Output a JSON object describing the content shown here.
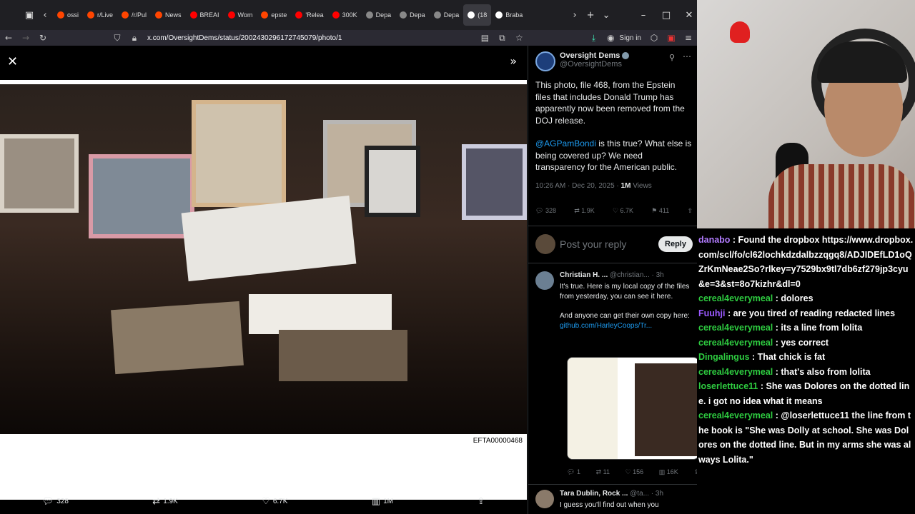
{
  "tabs": [
    {
      "label": "ossi",
      "color": "#ff4500"
    },
    {
      "label": "r/Live",
      "color": "#ff4500"
    },
    {
      "label": "/r/Pul",
      "color": "#ff4500"
    },
    {
      "label": "News",
      "color": "#ff4500"
    },
    {
      "label": "BREAI",
      "color": "#ff0000"
    },
    {
      "label": "Wom",
      "color": "#ff0000"
    },
    {
      "label": "epste",
      "color": "#ff4500"
    },
    {
      "label": "'Relea",
      "color": "#ff0000"
    },
    {
      "label": "300K",
      "color": "#ff0000"
    },
    {
      "label": "Depa",
      "color": "#888888"
    },
    {
      "label": "Depa",
      "color": "#888888"
    },
    {
      "label": "Depa",
      "color": "#888888"
    },
    {
      "label": "(18",
      "color": "#ffffff"
    },
    {
      "label": "Braba",
      "color": "#ffffff"
    }
  ],
  "url": "x.com/OversightDems/status/2002430296172745079/photo/1",
  "sign_in": "Sign in",
  "photo": {
    "caption_code": "EFTA00000468"
  },
  "viewer_actions": {
    "replies": "328",
    "reposts": "1.9K",
    "likes": "6.7K",
    "views": "1M"
  },
  "post": {
    "name": "Oversight Dems",
    "handle": "@OversightDems",
    "text1": "This photo, file 468, from the Epstein files that includes Donald Trump has apparently now been removed from the DOJ release.",
    "mention": "@AGPamBondi",
    "text2": " is this true? What else is being covered up? We need transparency for the American public.",
    "time": "10:26 AM · Dec 20, 2025 · ",
    "views_count": "1M",
    "views_label": " Views",
    "replies": "328",
    "reposts": "1.9K",
    "likes": "6.7K",
    "bookmarks": "411"
  },
  "reply": {
    "placeholder": "Post your reply",
    "button": "Reply"
  },
  "comment1": {
    "name": "Christian H. ...",
    "handle": "@christian... · 3h",
    "text1": "It's true. Here is my local copy of the files from yesterday, you can see it here.",
    "text2": "And anyone can get their own copy here:",
    "link": "github.com/HarleyCoops/Tr...",
    "replies": "1",
    "reposts": "11",
    "likes": "156",
    "views": "16K"
  },
  "comment2": {
    "name": "Tara Dublin, Rock ...",
    "handle": "@ta... · 3h",
    "text": "I guess you'll find out when you"
  },
  "chat": [
    {
      "user": "danabo",
      "color": "#b27cff",
      "text": " : Found the dropbox https://www.dropbox.com/scl/fo/cl62lochkdzdalbzzqgq8/ADJIDEfLD1oQZrKmNeae2So?rlkey=y7529bx9tl7db6zf279jp3cyu&e=3&st=8o7kizhr&dl=0"
    },
    {
      "user": "cereal4everymeal",
      "color": "#2ecc40",
      "text": " : dolores"
    },
    {
      "user": "Fuuhji",
      "color": "#9b59ff",
      "text": " : are you tired of reading redacted lines"
    },
    {
      "user": "cereal4everymeal",
      "color": "#2ecc40",
      "text": " : its a line from lolita"
    },
    {
      "user": "cereal4everymeal",
      "color": "#2ecc40",
      "text": " : yes correct"
    },
    {
      "user": "Dingalingus",
      "color": "#2ecc40",
      "text": " : That chick is fat"
    },
    {
      "user": "cereal4everymeal",
      "color": "#2ecc40",
      "text": " : that's also from lolita"
    },
    {
      "user": "loserlettuce11",
      "color": "#2ecc40",
      "text": " : She was Dolores on the dotted line. i got no idea what it means"
    },
    {
      "user": "cereal4everymeal",
      "color": "#2ecc40",
      "text": " : @loserlettuce11 the line from the book is \"She was Dolly at school. She was Dolores on the dotted line. But in my arms she was always Lolita.\""
    }
  ]
}
